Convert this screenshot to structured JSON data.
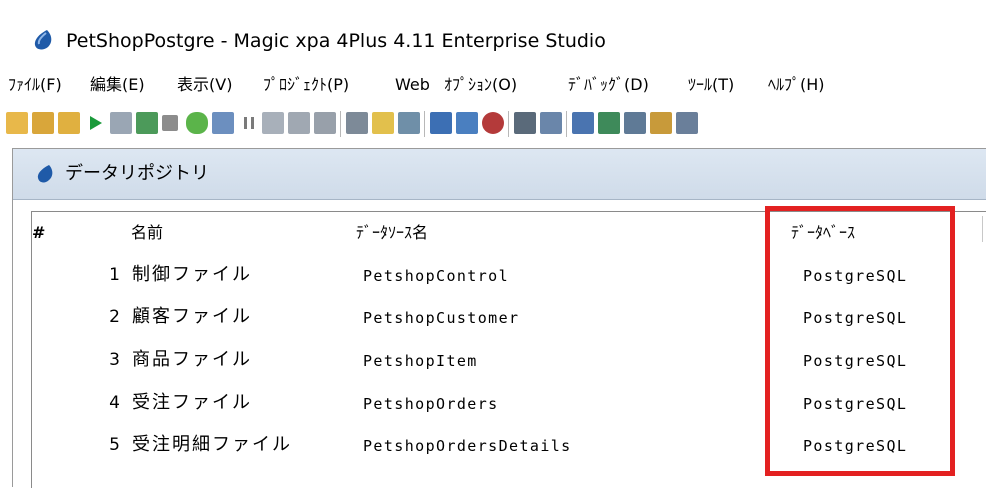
{
  "window": {
    "title": "PetShopPostgre - Magic xpa 4Plus 4.11 Enterprise Studio"
  },
  "menu": [
    "ﾌｧｲﾙ(F)",
    "編集(E)",
    "表示(V)",
    "ﾌﾟﾛｼﾞｪｸﾄ(P)",
    "Web",
    "ｵﾌﾟｼｮﾝ(O)",
    "ﾃﾞﾊﾞｯｸﾞ(D)",
    "ﾂｰﾙ(T)",
    "ﾍﾙﾌﾟ(H)"
  ],
  "toolbar_icons": [
    "new-project-icon",
    "open-project-icon",
    "open-folder-icon",
    "run-icon",
    "build-icon",
    "export-icon",
    "stop-icon",
    "android-icon",
    "preview-icon",
    "pause-icon",
    "step-icon",
    "step-into-icon",
    "step-out-icon",
    "device-icon",
    "wizard-icon",
    "checker-icon",
    "tree-icon",
    "structure-icon",
    "breakpoint-icon",
    "search-icon",
    "list-icon",
    "copy-icon",
    "paste-icon",
    "table-icon",
    "user-icon",
    "form-icon"
  ],
  "repository": {
    "title": "データリポジトリ",
    "columns": {
      "num": "#",
      "name": "名前",
      "source": "ﾃﾞｰﾀｿｰｽ名",
      "database": "ﾃﾞｰﾀﾍﾞｰｽ"
    },
    "rows": [
      {
        "num": "1",
        "name": "制御ファイル",
        "source": "PetshopControl",
        "database": "PostgreSQL"
      },
      {
        "num": "2",
        "name": "顧客ファイル",
        "source": "PetshopCustomer",
        "database": "PostgreSQL"
      },
      {
        "num": "3",
        "name": "商品ファイル",
        "source": "PetshopItem",
        "database": "PostgreSQL"
      },
      {
        "num": "4",
        "name": "受注ファイル",
        "source": "PetshopOrders",
        "database": "PostgreSQL"
      },
      {
        "num": "5",
        "name": "受注明細ファイル",
        "source": "PetshopOrdersDetails",
        "database": "PostgreSQL"
      }
    ]
  },
  "colors": {
    "highlight": "#e32121",
    "header_bg": "#d6e1ee",
    "app_icon": "#1f5aa8"
  }
}
